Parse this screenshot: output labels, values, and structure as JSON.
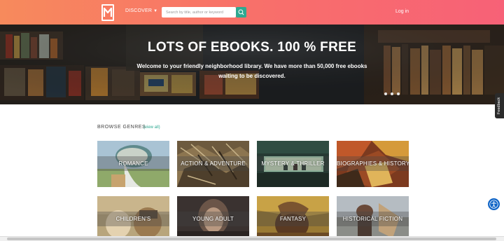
{
  "header": {
    "logo_icon": "book-logo-icon",
    "discover_label": "DISCOVER",
    "search_placeholder": "Search by title, author or keyword",
    "search_icon": "search-icon",
    "login_label": "Log in",
    "gradient": [
      "#f78a5c",
      "#f76177"
    ],
    "search_button_color": "#2ea991"
  },
  "hero": {
    "title": "LOTS OF EBOOKS. 100 % FREE",
    "subtitle": "Welcome to your friendly neighborhood library. We have more than 50,000 free ebooks waiting to be discovered.",
    "slide_count": 3
  },
  "feedback_label": "Feedback",
  "genres": {
    "heading": "BROWSE GENRES",
    "view_all": "(view all)",
    "items": [
      {
        "label": "ROMANCE"
      },
      {
        "label": "ACTION & ADVENTURE"
      },
      {
        "label": "MYSTERY & THRILLER"
      },
      {
        "label": "BIOGRAPHIES & HISTORY"
      },
      {
        "label": "CHILDREN'S"
      },
      {
        "label": "YOUNG ADULT"
      },
      {
        "label": "FANTASY"
      },
      {
        "label": "HISTORICAL FICTION"
      }
    ]
  },
  "accessibility_icon": "accessibility-icon"
}
